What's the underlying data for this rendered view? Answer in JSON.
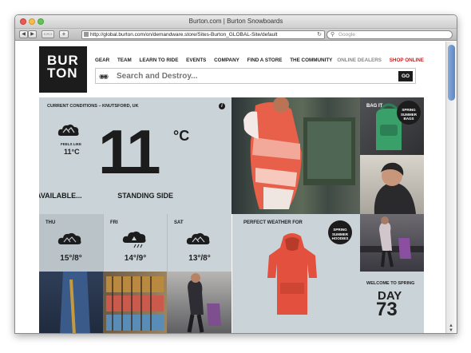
{
  "window": {
    "title": "Burton.com | Burton Snowboards"
  },
  "browser": {
    "url": "http://global.burton.com/on/demandware.store/Sites-Burton_GLOBAL-Site/default",
    "search_placeholder": "Google",
    "back_label": "◀",
    "forward_label": "▶",
    "bookmarks_label": "▭▭",
    "add_label": "+",
    "reload_label": "↻"
  },
  "site": {
    "logo_line1": "BUR",
    "logo_line2": "TON",
    "nav": [
      "GEAR",
      "TEAM",
      "LEARN TO RIDE",
      "EVENTS",
      "COMPANY",
      "FIND A STORE",
      "THE COMMUNITY"
    ],
    "online_dealers": "ONLINE DEALERS",
    "shop_online": "SHOP ONLINE",
    "search_placeholder": "Search and Destroy...",
    "search_icon_text": "◉◉",
    "go_label": "GO"
  },
  "weather": {
    "title": "CURRENT CONDITIONS – KNUTSFORD, UK",
    "info_glyph": "i",
    "feels_like_label": "FEELS LIKE",
    "feels_like_value": "11°C",
    "temp": "11",
    "unit": "°C",
    "ticker": [
      " AVAILABLE...",
      "STANDING SIDE"
    ],
    "forecast": [
      {
        "day": "THU",
        "temp": "15°/8°"
      },
      {
        "day": "FRI",
        "temp": "14°/9°"
      },
      {
        "day": "SAT",
        "temp": "13°/8°"
      }
    ]
  },
  "tiles": {
    "bag_it": "BAG IT",
    "bags_badge": [
      "SPRING",
      "SUMMER",
      "BAGS"
    ],
    "perfect_weather": "PERFECT WEATHER FOR",
    "hoodies_badge": [
      "SPRING",
      "SUMMER",
      "HOODIES"
    ],
    "welcome_spring": "WELCOME TO SPRING",
    "day_label": "DAY",
    "day_number": "73"
  },
  "colors": {
    "panel": "#c9d3d8",
    "dark": "#1c1c1c",
    "shop_red": "#d11a1a"
  }
}
